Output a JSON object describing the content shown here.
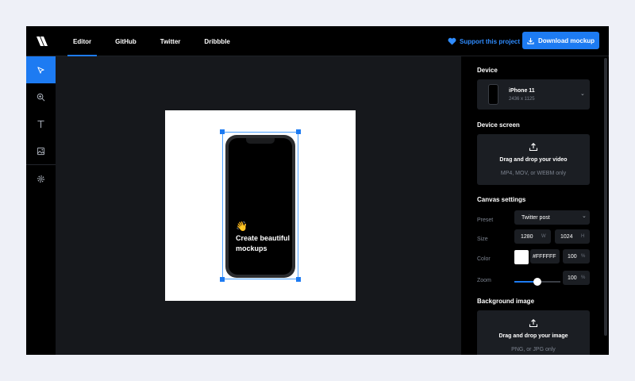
{
  "header": {
    "tabs": [
      {
        "label": "Editor",
        "active": true
      },
      {
        "label": "GitHub",
        "active": false
      },
      {
        "label": "Twitter",
        "active": false
      },
      {
        "label": "Dribbble",
        "active": false
      }
    ],
    "support_label": "Support this project",
    "download_label": "Download mockup"
  },
  "toolbar": {
    "tools": [
      {
        "icon": "cursor-icon",
        "active": true
      },
      {
        "icon": "zoom-in-icon",
        "active": false
      },
      {
        "icon": "text-icon",
        "active": false
      },
      {
        "icon": "image-icon",
        "active": false
      },
      {
        "icon": "gear-icon",
        "active": false
      }
    ]
  },
  "canvas": {
    "emoji": "👋",
    "text": "Create beautiful mockups"
  },
  "panel": {
    "device": {
      "title": "Device",
      "name": "iPhone 11",
      "resolution": "2436 x 1125"
    },
    "device_screen": {
      "title": "Device screen",
      "drop_title": "Drag and drop your video",
      "drop_hint": "MP4, MOV, or WEBM only"
    },
    "canvas_settings": {
      "title": "Canvas settings",
      "preset_label": "Preset",
      "preset_value": "Twitter post",
      "size_label": "Size",
      "width": "1280",
      "width_unit": "W",
      "height": "1024",
      "height_unit": "H",
      "color_label": "Color",
      "color_value": "#FFFFFF",
      "opacity": "100",
      "opacity_unit": "%",
      "zoom_label": "Zoom",
      "zoom_value": "100",
      "zoom_unit": "%",
      "zoom_fraction": 0.5
    },
    "background_image": {
      "title": "Background image",
      "drop_title": "Drag and drop your image",
      "drop_hint": "PNG, or JPG only"
    }
  },
  "colors": {
    "accent": "#1d7bf2",
    "support": "#2f8cff",
    "canvas_bg": "#FFFFFF"
  }
}
